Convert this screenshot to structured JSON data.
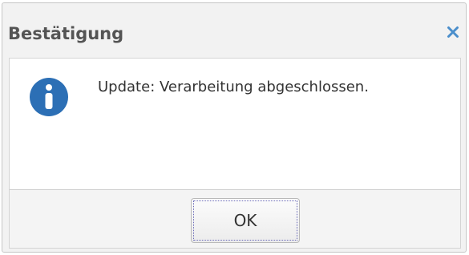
{
  "dialog": {
    "title": "Bestätigung",
    "close_icon": "close-icon",
    "icon": "info-icon",
    "message": "Update: Verarbeitung abgeschlossen.",
    "ok_label": "OK"
  },
  "colors": {
    "title_text": "#545454",
    "close_icon": "#4a8ecb",
    "info_icon": "#2c6fb5",
    "dialog_background": "#f2f2f2",
    "content_background": "#ffffff"
  }
}
